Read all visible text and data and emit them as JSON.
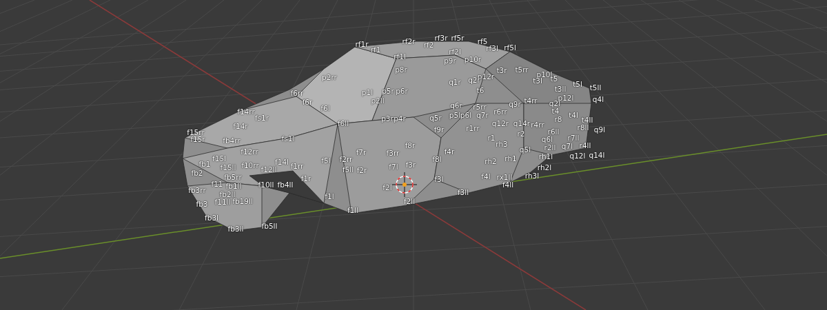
{
  "viewport": {
    "vertex_labels": [
      "rf1r",
      "rf1",
      "rf2r",
      "rf2",
      "rf3r",
      "rf5r",
      "rf5",
      "rf1l",
      "rf2l",
      "rf3l",
      "rf5l",
      "p9r",
      "p10r",
      "p8r",
      "p2rr",
      "p12r",
      "t3r",
      "t5rr",
      "p10l",
      "t3l",
      "t5",
      "t3ll",
      "t5l",
      "t5ll",
      "p12l",
      "q4l",
      "q1r",
      "q2r",
      "p1l",
      "p2ll",
      "p5r",
      "p6r",
      "t6",
      "f6rr",
      "f6r",
      "f6l",
      "f6ll",
      "f14rr",
      "fs1r",
      "f14r",
      "f15rr",
      "f15r",
      "fb4rr",
      "f12rr",
      "fs1l",
      "f14l",
      "f1rr",
      "f1r",
      "f7r",
      "f5l",
      "f2rr",
      "f5ll",
      "f2r",
      "f3rr",
      "f8r",
      "f7l",
      "f3r",
      "f2l",
      "f2ll",
      "f3l",
      "f3ll",
      "f8l",
      "f4r",
      "p3r",
      "p4r",
      "q5r",
      "f9r",
      "q6r",
      "p5l",
      "p6l",
      "r5rr",
      "q7r",
      "r6rr",
      "q9r",
      "t4rr",
      "q2l",
      "t4",
      "r8",
      "t4l",
      "t4ll",
      "r8ll",
      "q9l",
      "r7ll",
      "q7l",
      "r4ll",
      "q12l",
      "q14l",
      "r6ll",
      "q6l",
      "r2ll",
      "r1",
      "r2",
      "rh3",
      "rh2",
      "rh1",
      "q5l",
      "rh1l",
      "rh2l",
      "f4l",
      "rx1ll",
      "rh3l",
      "f4ll",
      "r1rr",
      "q12r",
      "q14r",
      "r4rr",
      "fb1",
      "fb2",
      "fb3rr",
      "fb3",
      "fb3l",
      "fb3ll",
      "fb5ll",
      "f11",
      "f11ll",
      "fb1ll",
      "fb2ll",
      "fb19ll",
      "f15ll",
      "f10rr",
      "f12ll",
      "f10ll",
      "fb4ll",
      "fb5rr",
      "f15l",
      "f1l",
      "f1ll"
    ]
  }
}
